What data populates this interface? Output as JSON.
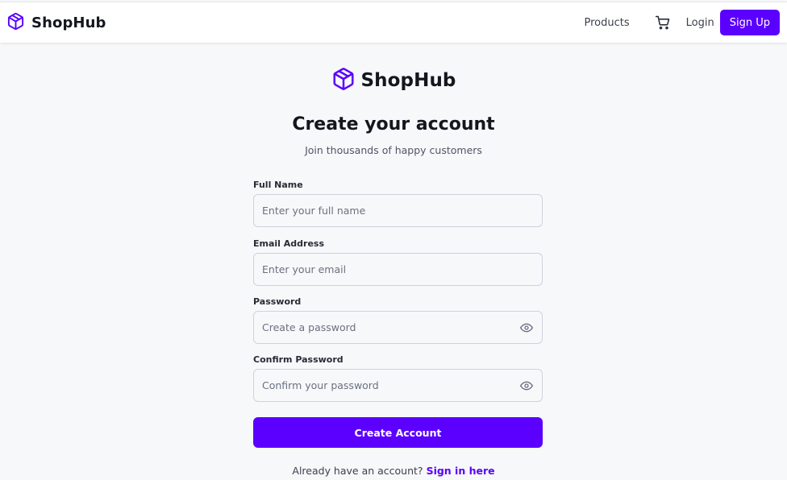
{
  "nav": {
    "brand": "ShopHub",
    "products": "Products",
    "login": "Login",
    "signup": "Sign Up"
  },
  "page": {
    "brand": "ShopHub",
    "title": "Create your account",
    "subtitle": "Join thousands of happy customers"
  },
  "form": {
    "full_name": {
      "label": "Full Name",
      "placeholder": "Enter your full name",
      "value": ""
    },
    "email": {
      "label": "Email Address",
      "placeholder": "Enter your email",
      "value": ""
    },
    "password": {
      "label": "Password",
      "placeholder": "Create a password",
      "value": ""
    },
    "confirm_password": {
      "label": "Confirm Password",
      "placeholder": "Confirm your password",
      "value": ""
    },
    "submit": "Create Account"
  },
  "footer": {
    "prompt": "Already have an account?",
    "link": "Sign in here"
  },
  "icons": {
    "brand": "cube-icon",
    "cart": "cart-icon",
    "toggle_password": "eye-icon"
  },
  "colors": {
    "accent": "#5b00ff",
    "background": "#f7f8fa",
    "navbar": "#ffffff"
  }
}
